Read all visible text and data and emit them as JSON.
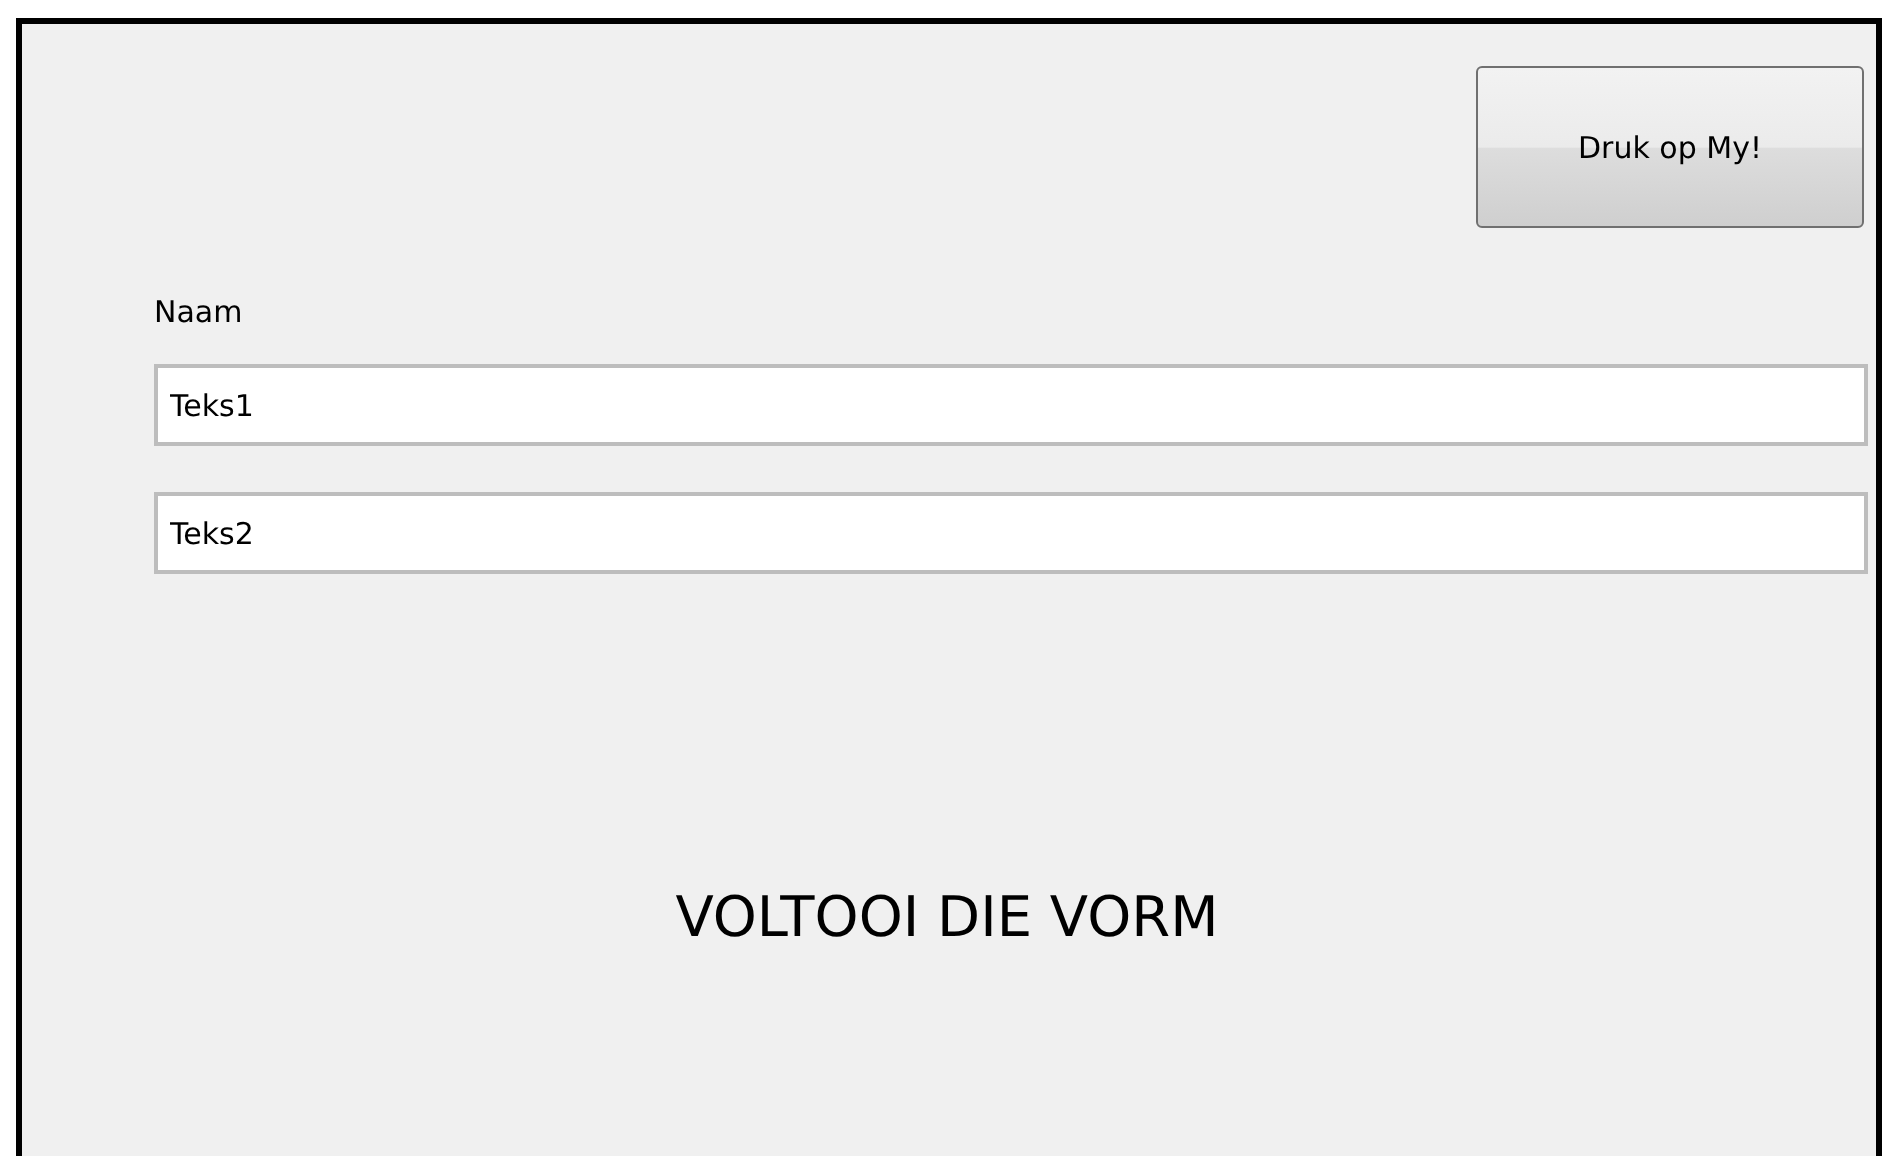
{
  "button": {
    "label": "Druk op My!"
  },
  "name_label": "Naam",
  "fields": [
    {
      "value": "Teks1"
    },
    {
      "value": "Teks2"
    }
  ],
  "heading": "VOLTOOI DIE VORM"
}
